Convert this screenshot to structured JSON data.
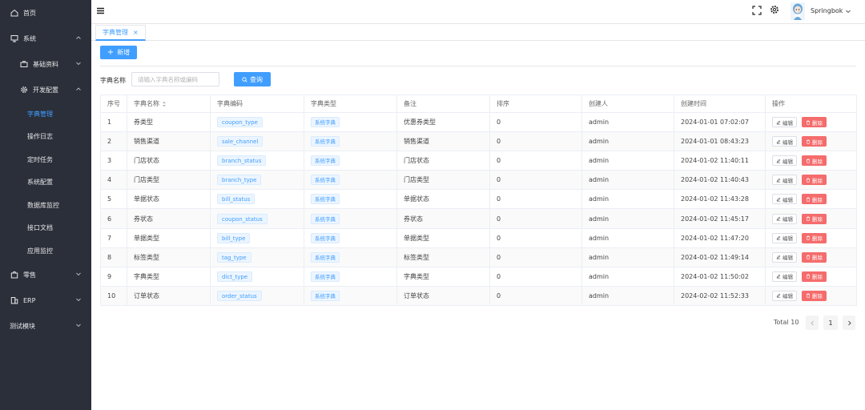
{
  "sidebar": {
    "items": [
      {
        "label": "首页",
        "icon": "home-icon"
      },
      {
        "label": "系统",
        "icon": "monitor-icon"
      },
      {
        "label": "基础资料",
        "icon": "briefcase-icon"
      },
      {
        "label": "开发配置",
        "icon": "gear-icon"
      },
      {
        "label": "字典管理"
      },
      {
        "label": "操作日志"
      },
      {
        "label": "定时任务"
      },
      {
        "label": "系统配置"
      },
      {
        "label": "数据库监控"
      },
      {
        "label": "接口文档"
      },
      {
        "label": "应用监控"
      },
      {
        "label": "零售",
        "icon": "bag-icon"
      },
      {
        "label": "ERP",
        "icon": "building-icon"
      },
      {
        "label": "测试模块"
      }
    ],
    "active_color": "#409eff",
    "bg_color": "#2b2f3a"
  },
  "header": {
    "username": "Springbok"
  },
  "tabs": [
    {
      "label": "字典管理",
      "close": "×"
    }
  ],
  "toolbar": {
    "add_label": "新增",
    "add_icon": "+"
  },
  "search": {
    "label": "字典名称",
    "placeholder": "请输入字典名称或编码",
    "query_label": "查询"
  },
  "table": {
    "headers": [
      "序号",
      "字典名称",
      "字典编码",
      "字典类型",
      "备注",
      "排序",
      "创建人",
      "创建时间",
      "操作"
    ],
    "rows": [
      {
        "no": "1",
        "name": "券类型",
        "code": "coupon_type",
        "type": "系统字典",
        "remark": "优惠券类型",
        "sort": "0",
        "creator": "admin",
        "time": "2024-01-01 07:02:07"
      },
      {
        "no": "2",
        "name": "销售渠道",
        "code": "sale_channel",
        "type": "系统字典",
        "remark": "销售渠道",
        "sort": "0",
        "creator": "admin",
        "time": "2024-01-01 08:43:23"
      },
      {
        "no": "3",
        "name": "门店状态",
        "code": "branch_status",
        "type": "系统字典",
        "remark": "门店状态",
        "sort": "0",
        "creator": "admin",
        "time": "2024-01-02 11:40:11"
      },
      {
        "no": "4",
        "name": "门店类型",
        "code": "branch_type",
        "type": "系统字典",
        "remark": "门店类型",
        "sort": "0",
        "creator": "admin",
        "time": "2024-01-02 11:40:43"
      },
      {
        "no": "5",
        "name": "单据状态",
        "code": "bill_status",
        "type": "系统字典",
        "remark": "单据状态",
        "sort": "0",
        "creator": "admin",
        "time": "2024-01-02 11:43:28"
      },
      {
        "no": "6",
        "name": "券状态",
        "code": "coupon_status",
        "type": "系统字典",
        "remark": "券状态",
        "sort": "0",
        "creator": "admin",
        "time": "2024-01-02 11:45:17"
      },
      {
        "no": "7",
        "name": "单据类型",
        "code": "bill_type",
        "type": "系统字典",
        "remark": "单据类型",
        "sort": "0",
        "creator": "admin",
        "time": "2024-01-02 11:47:20"
      },
      {
        "no": "8",
        "name": "标签类型",
        "code": "tag_type",
        "type": "系统字典",
        "remark": "标签类型",
        "sort": "0",
        "creator": "admin",
        "time": "2024-01-02 11:49:14"
      },
      {
        "no": "9",
        "name": "字典类型",
        "code": "dict_type",
        "type": "系统字典",
        "remark": "字典类型",
        "sort": "0",
        "creator": "admin",
        "time": "2024-01-02 11:50:02"
      },
      {
        "no": "10",
        "name": "订单状态",
        "code": "order_status",
        "type": "系统字典",
        "remark": "订单状态",
        "sort": "0",
        "creator": "admin",
        "time": "2024-02-02 11:52:33"
      }
    ],
    "edit_label": "编辑",
    "delete_label": "删除"
  },
  "pagination": {
    "total_label": "Total 10",
    "current_page": "1"
  },
  "colors": {
    "primary": "#409eff",
    "danger": "#f56c6c"
  }
}
